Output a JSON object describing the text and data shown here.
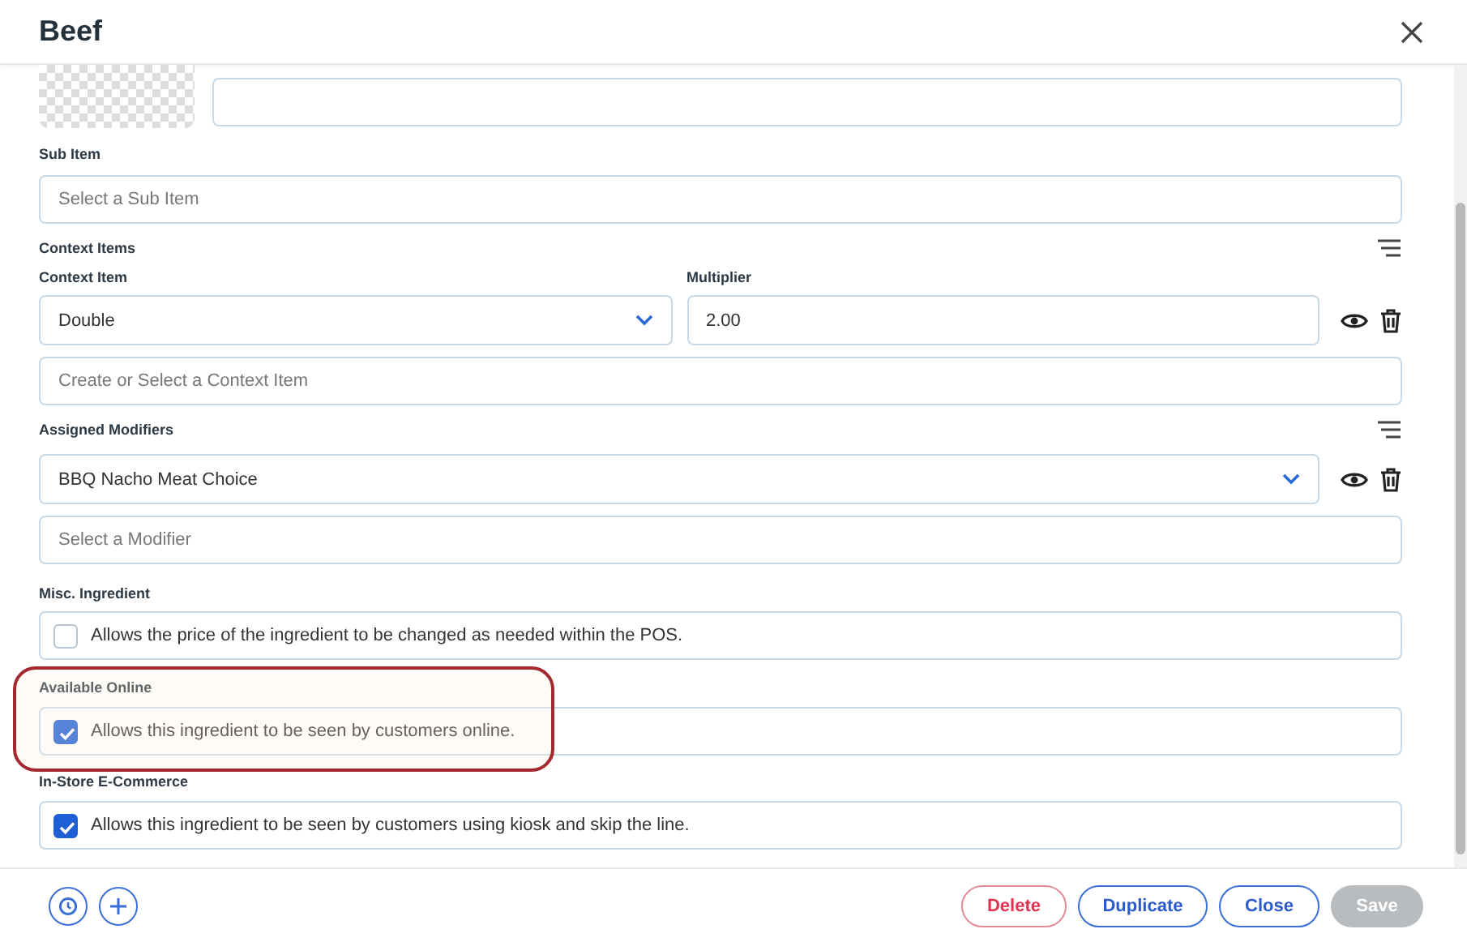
{
  "dialog": {
    "title": "Beef"
  },
  "sub_item": {
    "label": "Sub Item",
    "placeholder": "Select a Sub Item"
  },
  "context_items": {
    "label": "Context Items",
    "column_1": "Context Item",
    "column_2": "Multiplier",
    "rows": [
      {
        "item": "Double",
        "multiplier": "2.00"
      }
    ],
    "placeholder": "Create or Select a Context Item"
  },
  "assigned_modifiers": {
    "label": "Assigned Modifiers",
    "rows": [
      {
        "modifier": "BBQ Nacho Meat Choice"
      }
    ],
    "placeholder": "Select a Modifier"
  },
  "options": [
    {
      "label": "Misc. Ingredient",
      "text": "Allows the price of the ingredient to be changed as needed within the POS.",
      "checked": false,
      "highlighted": false
    },
    {
      "label": "Available Online",
      "text": "Allows this ingredient to be seen by customers online.",
      "checked": true,
      "highlighted": true
    },
    {
      "label": "In-Store E-Commerce",
      "text": "Allows this ingredient to be seen by customers using kiosk and skip the line.",
      "checked": true,
      "highlighted": false
    }
  ],
  "footer": {
    "buttons": [
      {
        "label": "Delete",
        "kind": "danger",
        "disabled": false
      },
      {
        "label": "Duplicate",
        "kind": "outline",
        "disabled": false
      },
      {
        "label": "Close",
        "kind": "outline",
        "disabled": false
      },
      {
        "label": "Save",
        "kind": "primary",
        "disabled": true
      }
    ]
  }
}
